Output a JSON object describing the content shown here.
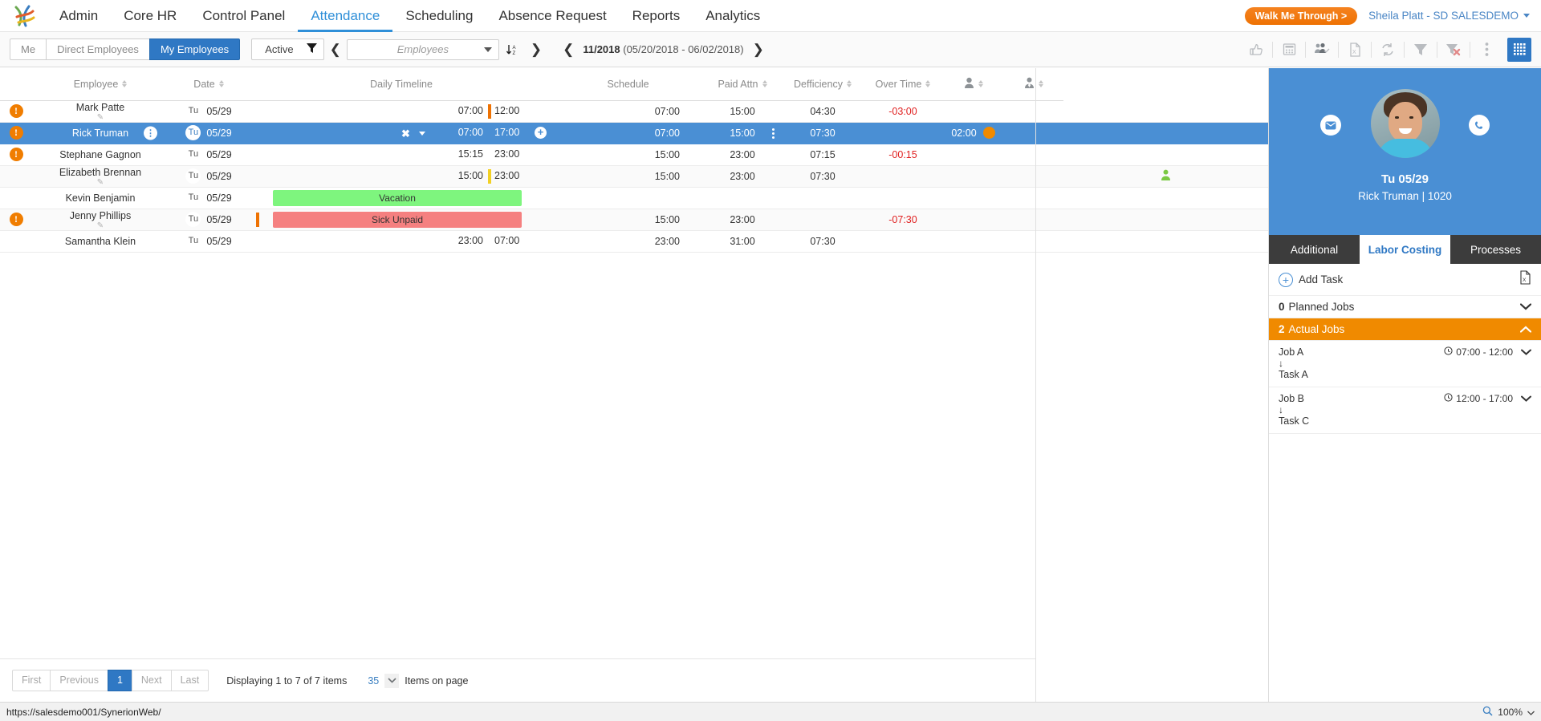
{
  "nav": {
    "logo": "synerion-logo",
    "links": [
      "Admin",
      "Core HR",
      "Control Panel",
      "Attendance",
      "Scheduling",
      "Absence Request",
      "Reports",
      "Analytics"
    ],
    "active": "Attendance",
    "walk_me_through": "Walk Me Through >",
    "user": "Sheila Platt - SD SALESDEMO"
  },
  "toolbar": {
    "scope_buttons": [
      "Me",
      "Direct Employees",
      "My Employees"
    ],
    "scope_active": "My Employees",
    "status_filter": "Active",
    "employee_placeholder": "Employees",
    "period": "11/2018",
    "period_range": "(05/20/2018 - 06/02/2018)",
    "icons": [
      "thumbs-up-icon",
      "calculator-icon",
      "employees-check-icon",
      "excel-export-icon",
      "refresh-icon",
      "filter-icon",
      "clear-filter-icon",
      "more-options-icon",
      "grid-view-icon"
    ]
  },
  "grid": {
    "columns": [
      {
        "label": "Employee",
        "sortable": true
      },
      {
        "label": "Date",
        "sortable": true
      },
      {
        "label": "Daily Timeline",
        "sortable": false
      },
      {
        "label": "Schedule",
        "sortable": false
      },
      {
        "label": "Paid Attn",
        "sortable": true
      },
      {
        "label": "Defficiency",
        "sortable": true
      },
      {
        "label": "Over Time",
        "sortable": true
      },
      {
        "label": "person-icon",
        "sortable": true
      },
      {
        "label": "person-tie-icon",
        "sortable": true
      }
    ],
    "rows": [
      {
        "alert": true,
        "employee": "Mark Patte",
        "editable": true,
        "day": "Tu",
        "date": "05/29",
        "timeline": {
          "type": "times",
          "in": "07:00",
          "out": "12:00",
          "marker": "orange"
        },
        "sched_start": "07:00",
        "sched_end": "15:00",
        "paid_attn": "04:30",
        "deficiency": "-03:00",
        "overtime": "",
        "selected": false
      },
      {
        "alert": true,
        "employee": "Rick Truman",
        "editable": false,
        "info": true,
        "day": "Tu",
        "date": "05/29",
        "timeline": {
          "type": "times",
          "in": "07:00",
          "out": "17:00",
          "marker": "none",
          "has_x": true,
          "has_plus": true
        },
        "sched_start": "07:00",
        "sched_end": "15:00",
        "sched_menu": true,
        "paid_attn": "07:30",
        "deficiency": "",
        "overtime": "02:00",
        "overtime_dot": true,
        "selected": true
      },
      {
        "alert": true,
        "employee": "Stephane Gagnon",
        "editable": false,
        "day": "Tu",
        "date": "05/29",
        "timeline": {
          "type": "times",
          "in": "15:15",
          "out": "23:00",
          "marker": "none"
        },
        "sched_start": "15:00",
        "sched_end": "23:00",
        "paid_attn": "07:15",
        "deficiency": "-00:15",
        "overtime": "",
        "selected": false
      },
      {
        "alert": false,
        "employee": "Elizabeth Brennan",
        "editable": true,
        "day": "Tu",
        "date": "05/29",
        "timeline": {
          "type": "times",
          "in": "15:00",
          "out": "23:00",
          "marker": "yellow"
        },
        "sched_start": "15:00",
        "sched_end": "23:00",
        "paid_attn": "07:30",
        "deficiency": "",
        "overtime": "",
        "person_icon": true,
        "selected": false
      },
      {
        "alert": false,
        "employee": "Kevin Benjamin",
        "editable": false,
        "day": "Tu",
        "date": "05/29",
        "timeline": {
          "type": "absence",
          "label": "Vacation",
          "color": "green"
        },
        "sched_start": "",
        "sched_end": "",
        "paid_attn": "",
        "deficiency": "",
        "overtime": "",
        "selected": false
      },
      {
        "alert": true,
        "employee": "Jenny Phillips",
        "editable": true,
        "day": "Tu",
        "date": "05/29",
        "timeline": {
          "type": "absence",
          "label": "Sick Unpaid",
          "color": "red",
          "marker": "orange"
        },
        "sched_start": "15:00",
        "sched_end": "23:00",
        "paid_attn": "",
        "deficiency": "-07:30",
        "overtime": "",
        "selected": false
      },
      {
        "alert": false,
        "employee": "Samantha Klein",
        "editable": false,
        "day": "Tu",
        "date": "05/29",
        "timeline": {
          "type": "times",
          "in": "23:00",
          "out": "07:00",
          "marker": "none"
        },
        "sched_start": "23:00",
        "sched_end": "31:00",
        "paid_attn": "07:30",
        "deficiency": "",
        "overtime": "",
        "selected": false
      }
    ]
  },
  "footer": {
    "pager": [
      "First",
      "Previous",
      "1",
      "Next",
      "Last"
    ],
    "current_page": "1",
    "displaying": "Displaying 1 to 7 of 7 items",
    "items_count": "35",
    "items_label": "Items on page"
  },
  "statusbar": {
    "url": "https://salesdemo001/SynerionWeb/",
    "zoom": "100%"
  },
  "right_panel": {
    "avatar": "employee-photo",
    "date": "Tu 05/29",
    "name_id": "Rick Truman | 1020",
    "mail_icon": "mail-icon",
    "phone_icon": "phone-icon",
    "tabs": [
      "Additional",
      "Labor Costing",
      "Processes"
    ],
    "active_tab": "Labor Costing",
    "add_task": "Add Task",
    "excel_icon": "excel-export-icon",
    "sections": [
      {
        "count": "0",
        "label": "Planned Jobs",
        "expanded": false
      },
      {
        "count": "2",
        "label": "Actual Jobs",
        "expanded": true
      }
    ],
    "jobs": [
      {
        "job": "Job A",
        "time": "07:00 - 12:00",
        "task": "Task A"
      },
      {
        "job": "Job B",
        "time": "12:00 - 17:00",
        "task": "Task C"
      }
    ]
  },
  "colors": {
    "accent_blue": "#2f78c4",
    "selected_row": "#4a8fd4",
    "orange": "#f08a00",
    "alert_orange": "#f07d00",
    "deficiency_red": "#e02020",
    "vacation_green": "#7ef57e",
    "sick_red": "#f58080"
  }
}
